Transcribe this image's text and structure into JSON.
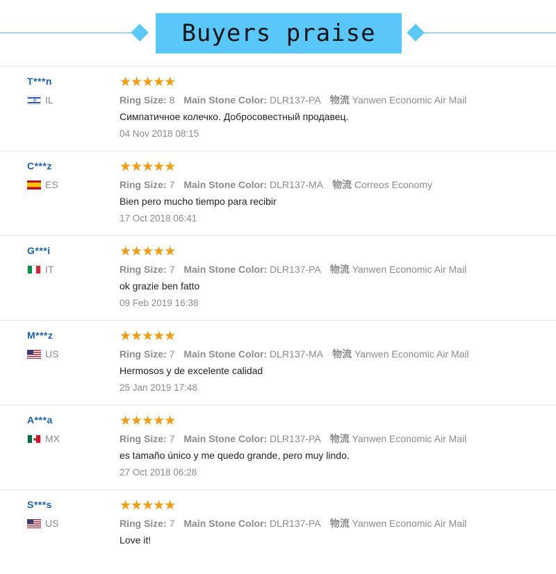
{
  "header": {
    "title": "Buyers praise"
  },
  "labels": {
    "ring_size": "Ring Size:",
    "main_stone_color": "Main Stone Color:",
    "logistics": "物流"
  },
  "reviews": [
    {
      "user": "T***n",
      "country": "IL",
      "stars": "★★★★★",
      "ring_size": "8",
      "stone_color": "DLR137-PA",
      "logistics": "Yanwen Economic Air Mail",
      "text": "Симпатичное колечко. Добросовестный продавец.",
      "date": "04 Nov 2018 08:15"
    },
    {
      "user": "C***z",
      "country": "ES",
      "stars": "★★★★★",
      "ring_size": "7",
      "stone_color": "DLR137-MA",
      "logistics": "Correos Economy",
      "text": "Bien pero mucho tiempo para recibir",
      "date": "17 Oct 2018 06:41"
    },
    {
      "user": "G***i",
      "country": "IT",
      "stars": "★★★★★",
      "ring_size": "7",
      "stone_color": "DLR137-PA",
      "logistics": "Yanwen Economic Air Mail",
      "text": "ok grazie ben fatto",
      "date": "09 Feb 2019 16:38"
    },
    {
      "user": "M***z",
      "country": "US",
      "stars": "★★★★★",
      "ring_size": "7",
      "stone_color": "DLR137-MA",
      "logistics": "Yanwen Economic Air Mail",
      "text": "Hermosos y de excelente calidad",
      "date": "25 Jan 2019 17:48"
    },
    {
      "user": "A***a",
      "country": "MX",
      "stars": "★★★★★",
      "ring_size": "7",
      "stone_color": "DLR137-PA",
      "logistics": "Yanwen Economic Air Mail",
      "text": "es tamaño único y me quedo grande, pero muy lindo.",
      "date": "27 Oct 2018 06:28"
    },
    {
      "user": "S***s",
      "country": "US",
      "stars": "★★★★★",
      "ring_size": "7",
      "stone_color": "DLR137-PA",
      "logistics": "Yanwen Economic Air Mail",
      "text": "Love it!",
      "date": ""
    }
  ]
}
